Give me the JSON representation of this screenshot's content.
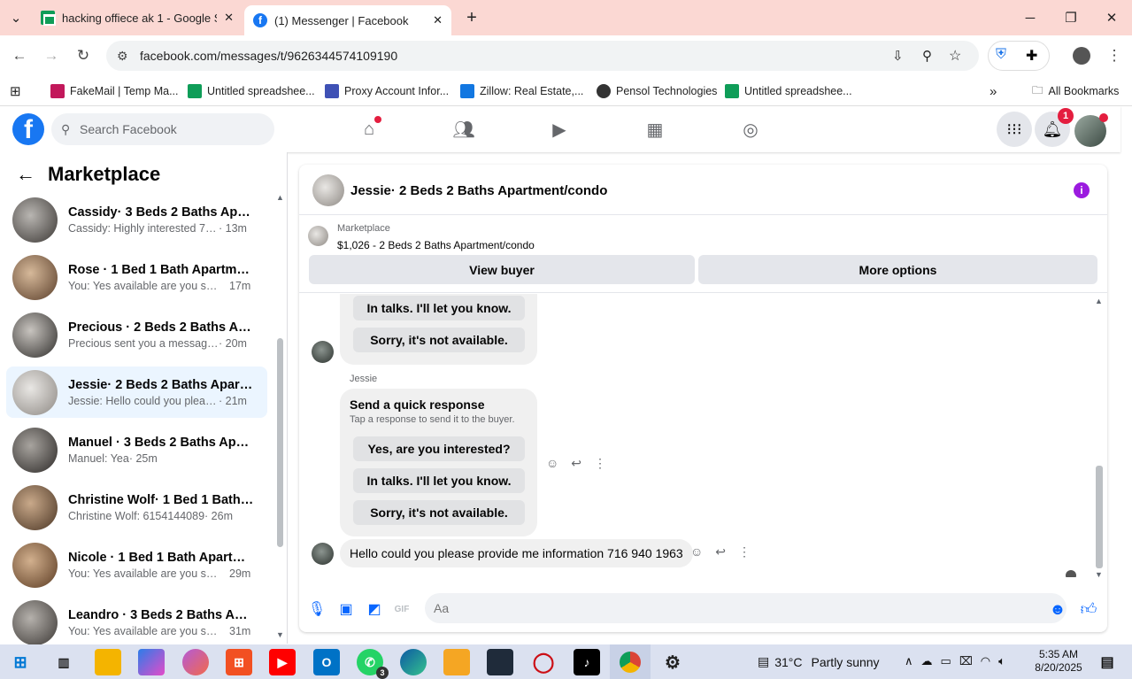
{
  "browser": {
    "tabs": [
      {
        "title": "hacking offiece ak 1 - Google Sh",
        "favicon": "sheets-icon"
      },
      {
        "title": "(1) Messenger | Facebook",
        "favicon": "facebook-icon"
      }
    ],
    "url": "facebook.com/messages/t/9626344574109190",
    "bookmarks": [
      {
        "label": "FakeMail | Temp Ma...",
        "color": "#c2185b"
      },
      {
        "label": "Untitled spreadshee...",
        "color": "#0f9d58"
      },
      {
        "label": "Proxy Account Infor...",
        "color": "#3f51b5"
      },
      {
        "label": "Zillow: Real Estate,...",
        "color": "#1277e1"
      },
      {
        "label": "Pensol Technologies",
        "color": "#333333"
      },
      {
        "label": "Untitled spreadshee...",
        "color": "#0f9d58"
      }
    ],
    "all_bookmarks": "All Bookmarks"
  },
  "fb": {
    "logo": "f",
    "search_placeholder": "Search Facebook",
    "notifications_count": "1"
  },
  "sidebar": {
    "title": "Marketplace",
    "conversations": [
      {
        "name": "Cassidy· 3 Beds 2 Baths Apartm...",
        "preview": "Cassidy: Highly interested 73129...",
        "time": "· 13m"
      },
      {
        "name": "Rose · 1 Bed 1 Bath Apartment/c...",
        "preview": "You: Yes available are you still int...",
        "time": "17m"
      },
      {
        "name": "Precious · 2 Beds 2 Baths Apart...",
        "preview": "Precious sent you a message abo...",
        "time": "· 20m"
      },
      {
        "name": "Jessie· 2 Beds 2 Baths Apartmen...",
        "preview": "Jessie: Hello could you please pr...",
        "time": "· 21m"
      },
      {
        "name": "Manuel · 3 Beds 2 Baths Apartm...",
        "preview": "Manuel: Yea",
        "time": "· 25m"
      },
      {
        "name": "Christine Wolf· 1 Bed 1 Bath Apa...",
        "preview": "Christine Wolf: 6154144089",
        "time": "· 26m"
      },
      {
        "name": "Nicole · 1 Bed 1 Bath Apartment...",
        "preview": "You: Yes available are you still int...",
        "time": "29m"
      },
      {
        "name": "Leandro · 3 Beds 2 Baths Apart...",
        "preview": "You: Yes available are you still int...",
        "time": "31m"
      }
    ]
  },
  "chat": {
    "title": "Jessie· 2 Beds 2 Baths Apartment/condo",
    "listing_source": "Marketplace",
    "listing_price": "$1,026 - 2 Beds 2 Baths Apartment/condo",
    "view_buyer": "View buyer",
    "more_options": "More options",
    "sender_name": "Jessie",
    "quick_title": "Send a quick response",
    "quick_sub": "Tap a response to send it to the buyer.",
    "quick_options": [
      "Yes, are you interested?",
      "In talks. I'll let you know.",
      "Sorry, it's not available."
    ],
    "message": "Hello could you please provide me information 716 940 1963",
    "input_placeholder": "Aa"
  },
  "taskbar": {
    "temperature": "31°C",
    "weather": "Partly sunny",
    "time": "5:35 AM",
    "date": "8/20/2025",
    "whatsapp_badge": "3"
  }
}
